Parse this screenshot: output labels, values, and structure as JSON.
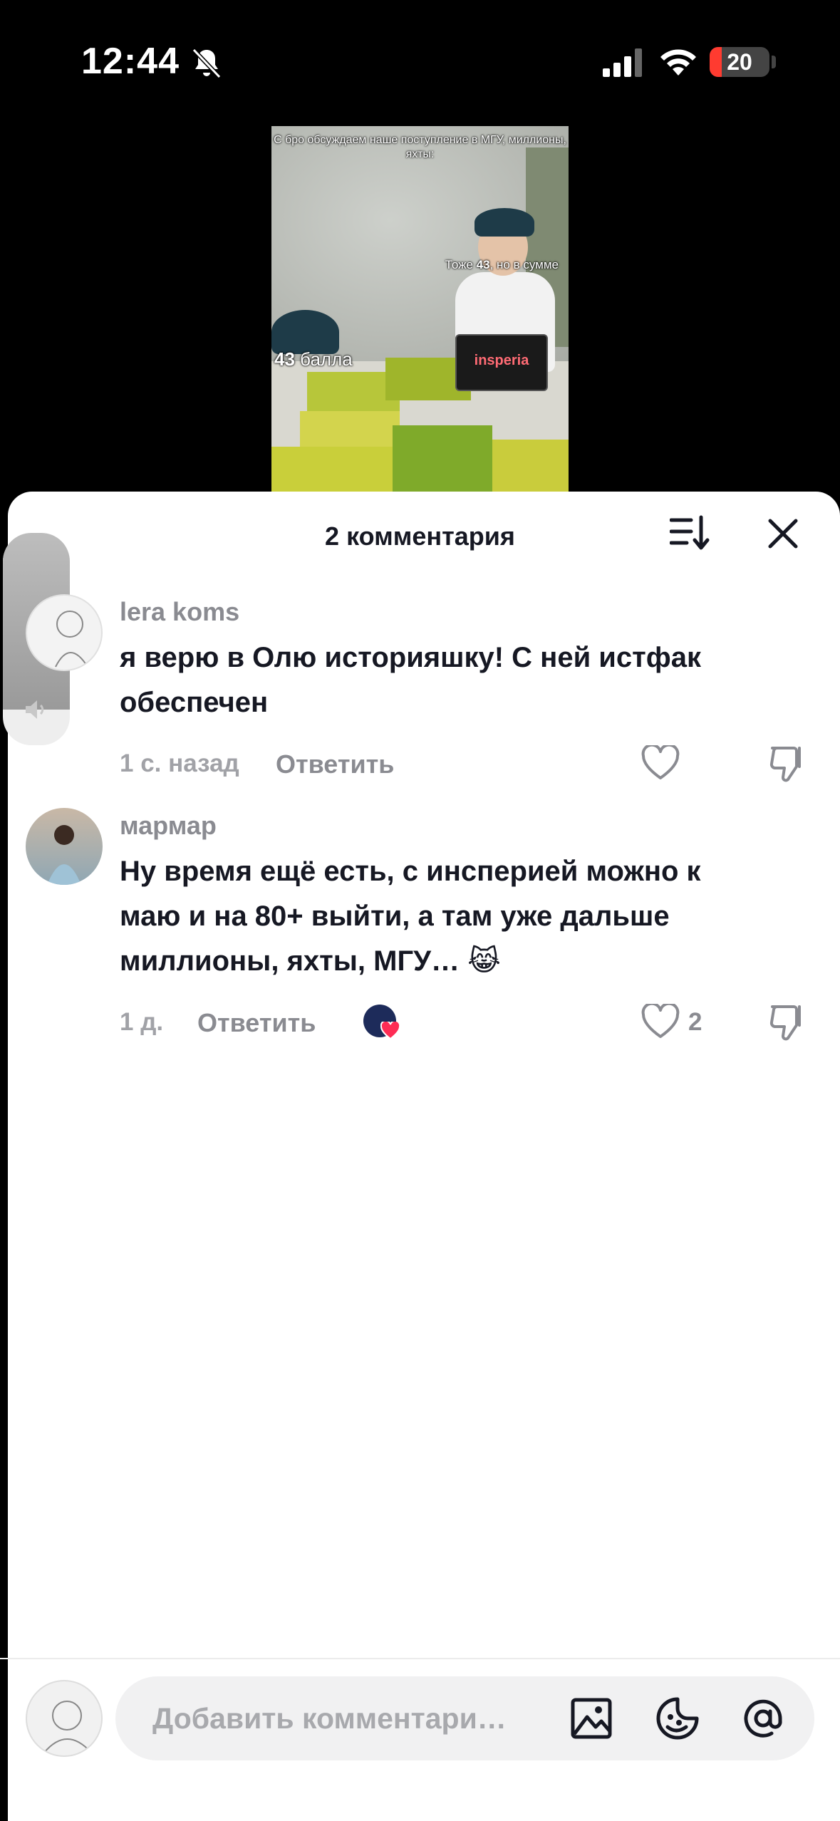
{
  "status_bar": {
    "time": "12:44",
    "battery": "20",
    "battery_level": 0.2,
    "icons": [
      "bell-slash-icon",
      "signal-icon",
      "wifi-icon",
      "battery-icon"
    ]
  },
  "video": {
    "caption_top": "С бро обсуждаем наше поступление в МГУ, миллионы, яхты:",
    "caption_right_prefix": "Тоже ",
    "caption_right_num": "43",
    "caption_right_suffix": ", но в сумме",
    "caption_left_num": "43",
    "caption_left_suffix": " балла",
    "laptop_brand": "insperia"
  },
  "sheet": {
    "title": "2 комментария"
  },
  "comments": [
    {
      "username": "lera koms",
      "text_line1": "я верю в Олю историяшку! С ней истфак",
      "text_line2": "обеспечен",
      "time": "1 с. назад",
      "reply_label": "Ответить",
      "likes": ""
    },
    {
      "username": "мармар",
      "text_line1": "Ну время ещё есть, с инсперией можно к",
      "text_line2": "маю и на 80+ выйти, а там уже дальше",
      "text_line3": "миллионы, яхты, МГУ… 😹",
      "time": "1 д.",
      "reply_label": "Ответить",
      "likes": "2"
    }
  ],
  "composer": {
    "placeholder": "Добавить комментари…"
  },
  "colors": {
    "accent_red": "#ff3b30",
    "heart_red": "#fe2c55",
    "text_primary": "#161823",
    "text_secondary": "#8a8b91"
  }
}
